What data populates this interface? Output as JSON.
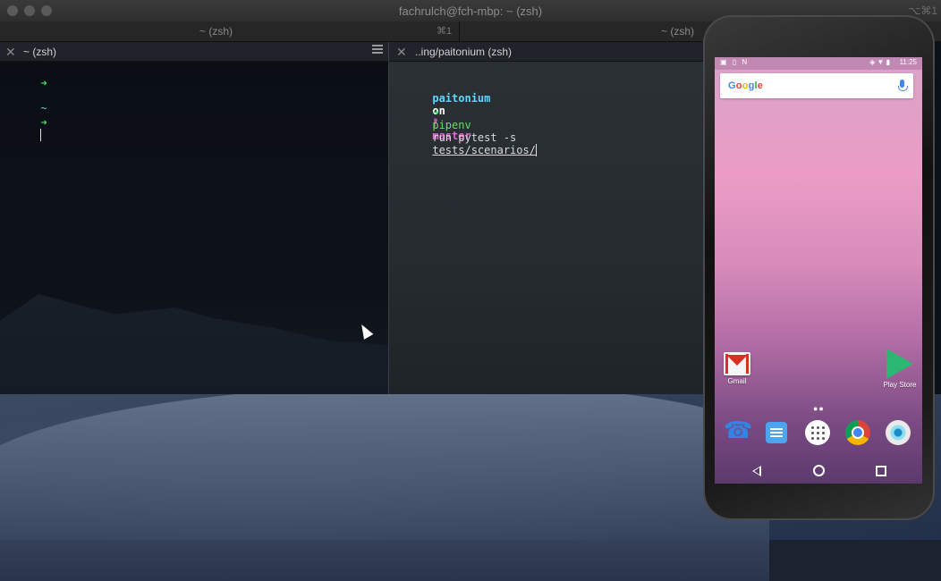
{
  "window": {
    "title": "fachrulch@fch-mbp: ~ (zsh)",
    "shortcut_right": "⌥⌘1"
  },
  "tabs": [
    {
      "label": "~ (zsh)",
      "shortcut": "⌘1"
    },
    {
      "label": "~ (zsh)",
      "shortcut": ""
    }
  ],
  "panes": {
    "left": {
      "title": "~ (zsh)",
      "lines": {
        "arrow1": "➜",
        "tilde": "~",
        "arrow2": "➜"
      }
    },
    "right": {
      "title": "..ing/paitonium (zsh)",
      "prompt_user": "paitonium",
      "prompt_on": "on",
      "branch_icon": "ᚠ",
      "branch": "master",
      "arrow": "➜",
      "cmd": "pipenv",
      "args": "run pytest -s",
      "path": "tests/scenarios/"
    }
  },
  "phone": {
    "status_left": "▣ ▯ N",
    "status_icons": "◈ ▼ ▮",
    "status_time": "11:25",
    "google_letters": [
      "G",
      "o",
      "o",
      "g",
      "l",
      "e"
    ],
    "google_colors": [
      "#4285f4",
      "#ea4335",
      "#fbbc05",
      "#4285f4",
      "#34a853",
      "#ea4335"
    ],
    "apps": [
      {
        "label": "Gmail",
        "icon": "gmail-icon"
      },
      {
        "label": "Play Store",
        "icon": "play-store-icon"
      }
    ],
    "page_dots": "●●",
    "dock": [
      "phone-icon",
      "messages-icon",
      "apps-icon",
      "chrome-icon",
      "camera-icon"
    ]
  }
}
